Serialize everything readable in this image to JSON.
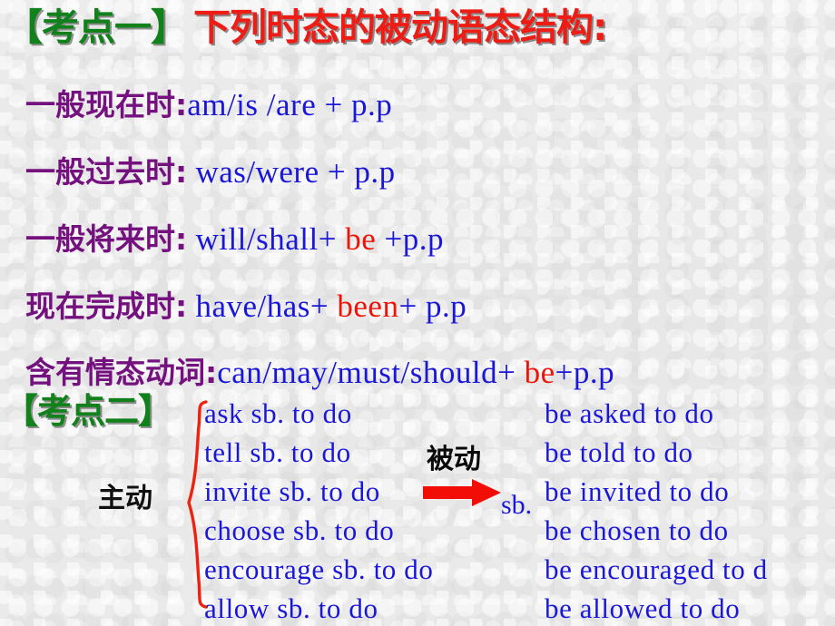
{
  "slide": {
    "background_color": "#e9e9e9",
    "colors": {
      "green": "#10811b",
      "red": "#ed1c15",
      "purple": "#74117f",
      "blue": "#1a17d8",
      "black": "#0a0a0a",
      "arrow_red": "#f20d06",
      "brace_red": "#ee2211"
    }
  },
  "heading1": {
    "tag": "【考点一】",
    "text": "下列时态的被动语态结构:"
  },
  "tenses": [
    {
      "label": "一般现在时:",
      "parts": [
        {
          "text": "am/is /are + p.p",
          "color": "blue"
        }
      ]
    },
    {
      "label": "一般过去时:",
      "parts": [
        {
          "text": " was/were + p.p",
          "color": "blue"
        }
      ]
    },
    {
      "label": "一般将来时:",
      "parts": [
        {
          "text": " will/shall+ ",
          "color": "blue"
        },
        {
          "text": "be",
          "color": "red"
        },
        {
          "text": " +p.p",
          "color": "blue"
        }
      ]
    },
    {
      "label": "现在完成时:",
      "parts": [
        {
          "text": " have/has+ ",
          "color": "blue"
        },
        {
          "text": "been",
          "color": "red"
        },
        {
          "text": "+ p.p",
          "color": "blue"
        }
      ]
    },
    {
      "label": "含有情态动词:",
      "parts": [
        {
          "text": "can/may/must/should+ ",
          "color": "blue"
        },
        {
          "text": "be",
          "color": "red"
        },
        {
          "text": "+p.p",
          "color": "blue"
        }
      ]
    }
  ],
  "heading2": {
    "tag": "【考点二】"
  },
  "voice_labels": {
    "active": "主动",
    "passive": "被动",
    "object": "sb."
  },
  "verb_pairs": {
    "rows": [
      {
        "active": "ask sb. to do",
        "passive": "be asked to do"
      },
      {
        "active": "tell sb. to do",
        "passive": "be told to do"
      },
      {
        "active": "invite sb. to do",
        "passive": "be invited to do"
      },
      {
        "active": "choose sb. to do",
        "passive": "be chosen to do"
      },
      {
        "active": "encourage sb. to do",
        "passive": "be encouraged to d"
      },
      {
        "active": "allow sb. to do",
        "passive": "be allowed to do"
      }
    ]
  }
}
